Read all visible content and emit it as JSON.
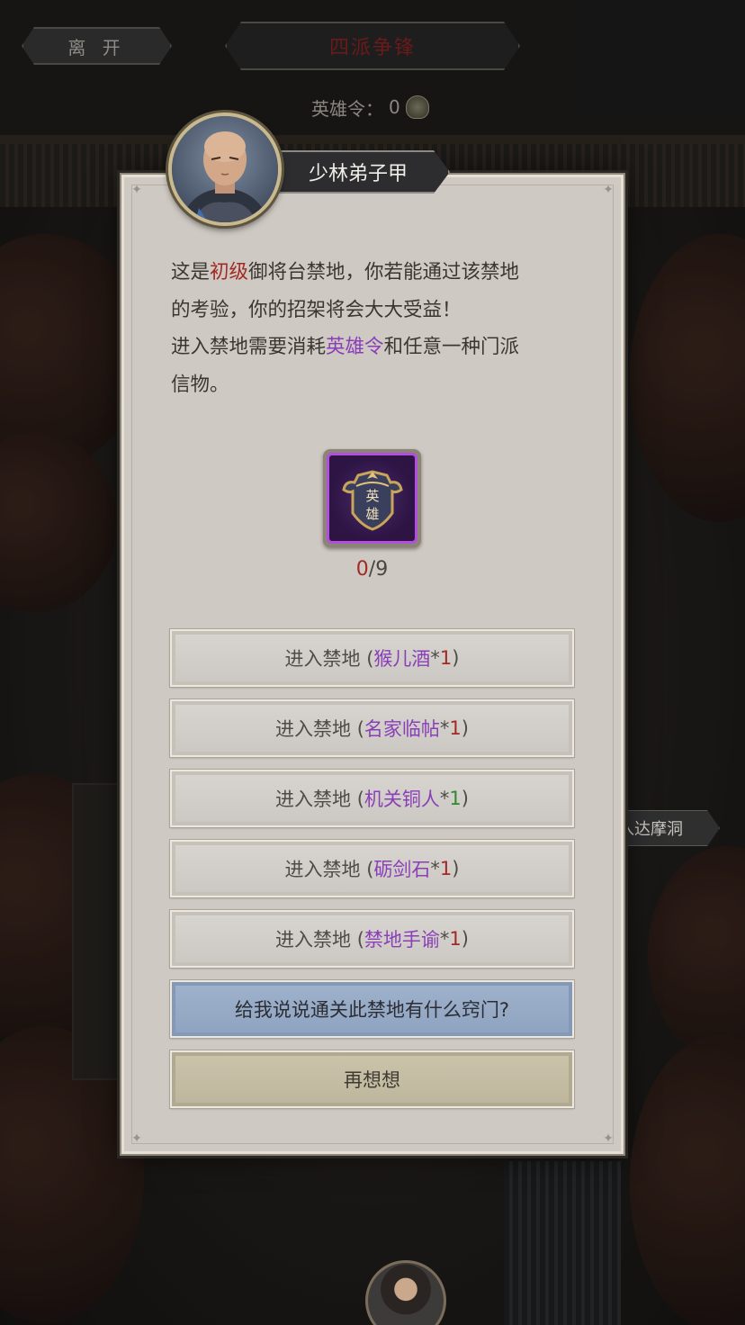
{
  "nav": {
    "leave_label": "离 开",
    "title": "四派争锋",
    "token_label": "英雄令：",
    "token_value": "0"
  },
  "side_button": {
    "label": "入达摩洞"
  },
  "npc": {
    "name": "少林弟子甲"
  },
  "dialog": {
    "line1_a": "这是",
    "line1_level": "初级",
    "line1_b": "御将台禁地，你若能通过该禁地",
    "line2": "的考验，你的招架将会大大受益！",
    "line3_a": "进入禁地需要消耗",
    "line3_item": "英雄令",
    "line3_b": "和任意一种门派",
    "line4": "信物。"
  },
  "required_item": {
    "icon": "hero-token-emblem",
    "glyph_top": "英",
    "glyph_bottom": "雄",
    "have": "0",
    "need": "/9"
  },
  "options": [
    {
      "prefix": "进入禁地 (",
      "item": "猴儿酒",
      "qty_star": "*",
      "qty": "1",
      "suffix": ")",
      "qty_color": "red"
    },
    {
      "prefix": "进入禁地 (",
      "item": "名家临帖",
      "qty_star": "*",
      "qty": "1",
      "suffix": ")",
      "qty_color": "red"
    },
    {
      "prefix": "进入禁地 (",
      "item": "机关铜人",
      "qty_star": "*",
      "qty": "1",
      "suffix": ")",
      "qty_color": "green"
    },
    {
      "prefix": "进入禁地 (",
      "item": "砺剑石",
      "qty_star": "*",
      "qty": "1",
      "suffix": ")",
      "qty_color": "red"
    },
    {
      "prefix": "进入禁地 (",
      "item": "禁地手谕",
      "qty_star": "*",
      "qty": "1",
      "suffix": ")",
      "qty_color": "red"
    }
  ],
  "hint_button": {
    "label": "给我说说通关此禁地有什么窍门?"
  },
  "cancel_button": {
    "label": "再想想"
  },
  "colors": {
    "accent_red": "#a22a24",
    "accent_purple": "#8a3fb8",
    "accent_green": "#2e8a2e",
    "hint_blue": "#9fb2cc",
    "panel_bg": "#cfc9c3"
  }
}
